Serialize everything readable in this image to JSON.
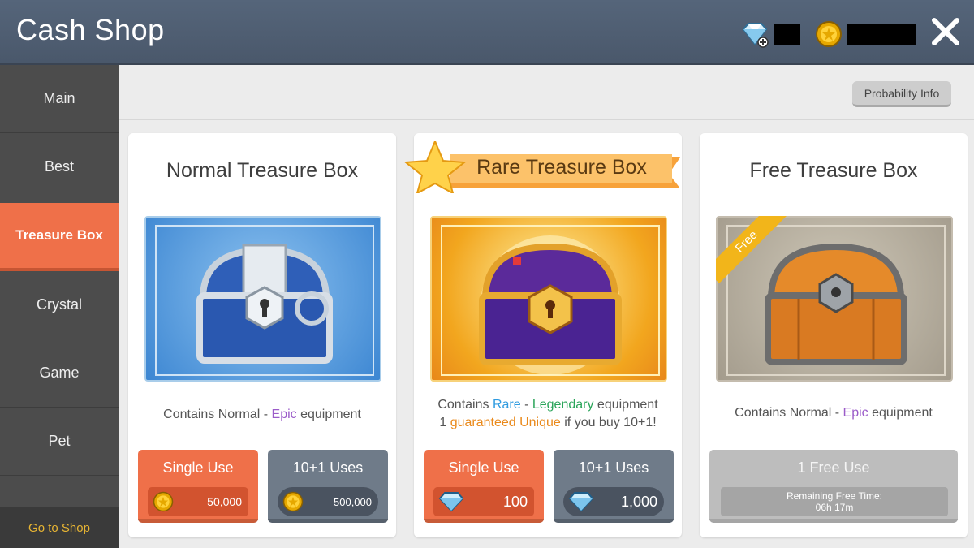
{
  "header": {
    "title": "Cash Shop",
    "crystal_icon": "diamond-plus-icon",
    "gold_icon": "gold-coin-icon",
    "close_icon": "close-icon"
  },
  "sidebar": {
    "items": [
      {
        "label": "Main"
      },
      {
        "label": "Best"
      },
      {
        "label": "Treasure Box",
        "active": true
      },
      {
        "label": "Crystal"
      },
      {
        "label": "Game"
      },
      {
        "label": "Pet"
      }
    ],
    "go_to_shop": "Go to Shop"
  },
  "main": {
    "probability_info": "Probability Info",
    "cards": [
      {
        "title": "Normal Treasure Box",
        "desc_a": "Contains Normal - ",
        "desc_b": "Epic",
        "desc_c": " equipment",
        "buttons": [
          {
            "label": "Single Use",
            "price": "50,000",
            "currency_icon": "gold-coin-icon"
          },
          {
            "label": "10+1 Uses",
            "price": "500,000",
            "currency_icon": "gold-coin-icon"
          }
        ]
      },
      {
        "title": "Rare Treasure Box",
        "desc_line1_a": "Contains ",
        "desc_line1_b": "Rare",
        "desc_line1_c": " - ",
        "desc_line1_d": "Legendary",
        "desc_line1_e": " equipment",
        "desc_line2_a": "1 ",
        "desc_line2_b": "guaranteed Unique",
        "desc_line2_c": " if you buy 10+1!",
        "buttons": [
          {
            "label": "Single Use",
            "price": "100",
            "currency_icon": "diamond-icon"
          },
          {
            "label": "10+1 Uses",
            "price": "1,000",
            "currency_icon": "diamond-icon"
          }
        ]
      },
      {
        "title": "Free Treasure Box",
        "ribbon": "Free",
        "desc_a": "Contains Normal - ",
        "desc_b": "Epic",
        "desc_c": " equipment",
        "free_button": {
          "label": "1 Free Use",
          "remaining_label": "Remaining Free Time:",
          "remaining_value": "06h 17m"
        }
      }
    ]
  },
  "colors": {
    "accent_orange": "#ef7049",
    "epic": "#9b5cc9",
    "rare": "#2f9be0",
    "legendary": "#2aa55a",
    "unique": "#ea8a1c"
  }
}
